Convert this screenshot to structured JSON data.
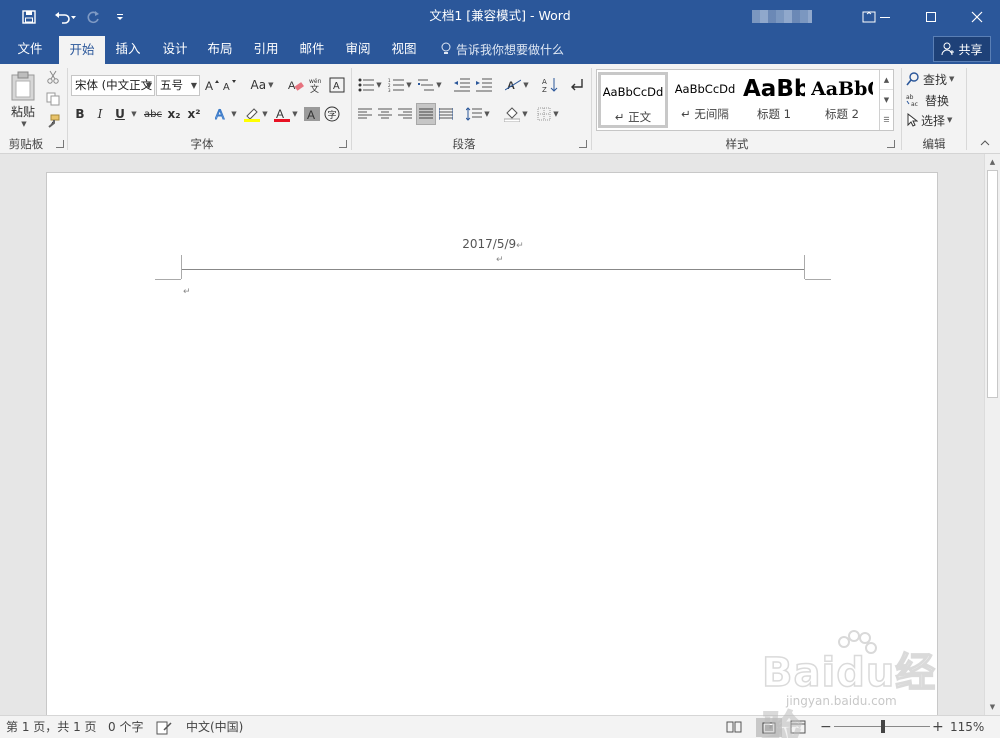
{
  "window": {
    "title": "文档1 [兼容模式] - Word"
  },
  "tabs": [
    {
      "label": "文件"
    },
    {
      "label": "开始"
    },
    {
      "label": "插入"
    },
    {
      "label": "设计"
    },
    {
      "label": "布局"
    },
    {
      "label": "引用"
    },
    {
      "label": "邮件"
    },
    {
      "label": "审阅"
    },
    {
      "label": "视图"
    }
  ],
  "tell_me": "告诉我你想要做什么",
  "share_label": "共享",
  "clipboard": {
    "paste_label": "粘贴",
    "group_label": "剪贴板"
  },
  "font": {
    "name": "宋体 (中文正文",
    "size": "五号",
    "group_label": "字体",
    "change_case": "Aa",
    "bold": "B",
    "italic": "I",
    "underline": "U",
    "strike": "abc",
    "sub": "x₂",
    "sup": "x²"
  },
  "paragraph": {
    "group_label": "段落"
  },
  "styles": {
    "group_label": "样式",
    "items": [
      {
        "sample": "AaBbCcDd",
        "name": "↵ 正文"
      },
      {
        "sample": "AaBbCcDd",
        "name": "↵ 无间隔"
      },
      {
        "sample": "AaBb",
        "name": "标题 1"
      },
      {
        "sample": "AaBbC",
        "name": "标题 2"
      }
    ]
  },
  "editing": {
    "group_label": "编辑",
    "find": "查找",
    "replace": "替换",
    "select": "选择"
  },
  "document": {
    "header_text": "2017/5/9",
    "para_mark": "↵"
  },
  "status": {
    "page": "第 1 页，共 1 页",
    "words": "0 个字",
    "language": "中文(中国)",
    "zoom": "115%",
    "zoom_minus": "−",
    "zoom_plus": "+"
  },
  "watermark": {
    "brand": "Baidu经验",
    "url": "jingyan.baidu.com"
  }
}
